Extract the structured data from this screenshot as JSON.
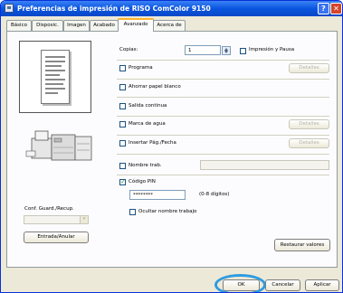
{
  "window": {
    "title": "Preferencias de impresión de RISO ComColor 9150"
  },
  "tabs": [
    {
      "label": "Básico"
    },
    {
      "label": "Disposic."
    },
    {
      "label": "Imagen"
    },
    {
      "label": "Acabado"
    },
    {
      "label": "Avanzado"
    },
    {
      "label": "Acerca de"
    }
  ],
  "copies": {
    "label": "Copias:",
    "value": "1",
    "pause_label": "Impresión y Pausa"
  },
  "options": {
    "programa": "Programa",
    "ahorrar": "Ahorrar papel blanco",
    "salida": "Salida continua",
    "marca": "Marca de agua",
    "insertar": "Insertar Pág./Fecha",
    "nombre_trab": "Nombre trab.",
    "codigo_pin": "Código PIN",
    "pin_value": "********",
    "pin_hint": "(0-8 dígitos)",
    "ocultar": "Ocultar nombre trabajo",
    "details_label": "Detalles"
  },
  "left": {
    "conf_label": "Conf. Guard./Recup.",
    "entrada_button": "Entrada/Anular"
  },
  "buttons": {
    "restaurar": "Restaurar valores",
    "ok": "OK",
    "cancelar": "Cancelar",
    "aplicar": "Aplicar"
  }
}
